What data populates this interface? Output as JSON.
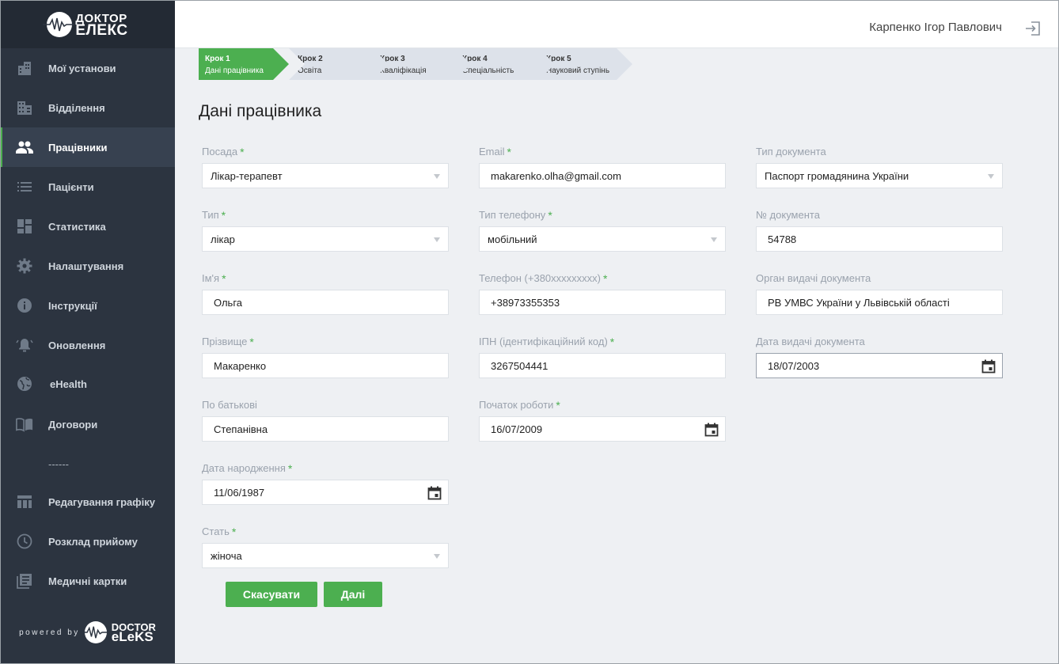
{
  "brand": {
    "line1": "ДОКТОР",
    "line2": "ЕЛЕКС"
  },
  "sidebar": {
    "items": [
      {
        "label": "Мої установи",
        "icon": "buildings-icon"
      },
      {
        "label": "Відділення",
        "icon": "office-icon"
      },
      {
        "label": "Працівники",
        "icon": "people-icon",
        "active": true
      },
      {
        "label": "Пацієнти",
        "icon": "list-icon"
      },
      {
        "label": "Статистика",
        "icon": "dashboard-icon"
      },
      {
        "label": "Налаштування",
        "icon": "gear-icon"
      },
      {
        "label": "Інструкції",
        "icon": "info-icon"
      },
      {
        "label": "Оновлення",
        "icon": "bell-icon"
      },
      {
        "label": "eHealth",
        "icon": "globe-icon"
      },
      {
        "label": "Договори",
        "icon": "book-icon"
      },
      {
        "label": "------",
        "icon": ""
      },
      {
        "label": "Редагування графіку",
        "icon": "table-icon"
      },
      {
        "label": "Розклад прийому",
        "icon": "clock-icon"
      },
      {
        "label": "Медичні картки",
        "icon": "cards-icon"
      }
    ],
    "powered_by": "powered by",
    "powered_logo_1": "DOCTOR",
    "powered_logo_2": "eLeKS"
  },
  "header": {
    "user_name": "Карпенко Ігор Павлович"
  },
  "steps": [
    {
      "num": "Крок 1",
      "label": "Дані працівника",
      "active": true
    },
    {
      "num": "Крок 2",
      "label": "Освіта"
    },
    {
      "num": "Крок 3",
      "label": "Кваліфікація"
    },
    {
      "num": "Крок 4",
      "label": "Спеціальність"
    },
    {
      "num": "Крок 5",
      "label": "Науковий ступінь"
    }
  ],
  "page_title": "Дані працівника",
  "form": {
    "position": {
      "label": "Посада",
      "value": "Лікар-терапевт"
    },
    "type": {
      "label": "Тип",
      "value": "лікар"
    },
    "first_name": {
      "label": "Ім'я",
      "value": "Ольга"
    },
    "last_name": {
      "label": "Прізвище",
      "value": "Макаренко"
    },
    "patronymic": {
      "label": "По батькові",
      "value": "Степанівна"
    },
    "birth_date": {
      "label": "Дата народження",
      "value": "11/06/1987"
    },
    "gender": {
      "label": "Стать",
      "value": "жіноча"
    },
    "email": {
      "label": "Email",
      "value": "makarenko.olha@gmail.com"
    },
    "phone_type": {
      "label": "Тип телефону",
      "value": "мобільний"
    },
    "phone": {
      "label": "Телефон (+380xxxxxxxxx)",
      "value": "+38973355353"
    },
    "tax_id": {
      "label": "ІПН (ідентифікаційний код)",
      "value": "3267504441"
    },
    "start_date": {
      "label": "Початок роботи",
      "value": "16/07/2009"
    },
    "doc_type": {
      "label": "Тип документа",
      "value": "Паспорт громадянина України"
    },
    "doc_number": {
      "label": "№ документа",
      "value": "54788"
    },
    "doc_issuer": {
      "label": "Орган видачі документа",
      "value": "РВ УМВС України у Львівській області"
    },
    "doc_date": {
      "label": "Дата видачі документа",
      "value": "18/07/2003"
    }
  },
  "buttons": {
    "cancel": "Скасувати",
    "next": "Далі"
  },
  "colors": {
    "accent": "#4caf50",
    "sidebar": "#2c3440",
    "sidebar_header": "#232a34",
    "step_bg": "#dde2ea"
  }
}
